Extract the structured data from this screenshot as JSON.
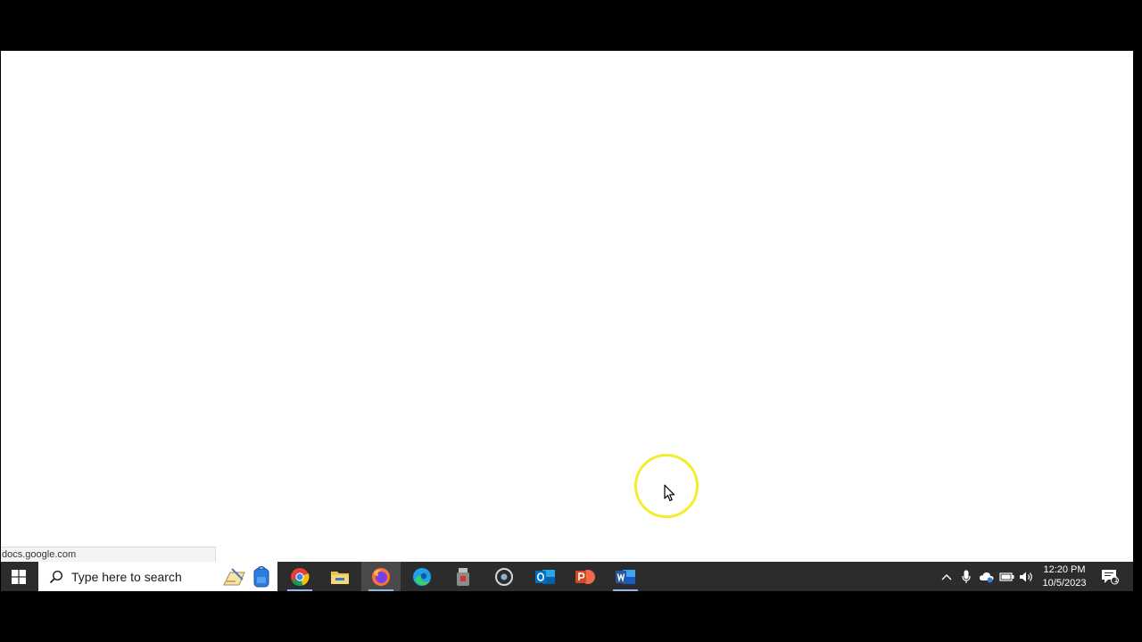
{
  "status_bar": {
    "url": "docs.google.com"
  },
  "taskbar": {
    "search_placeholder": "Type here to search",
    "apps": [
      {
        "name": "sticky-notes-icon"
      },
      {
        "name": "backpack-icon"
      },
      {
        "name": "chrome-icon"
      },
      {
        "name": "file-explorer-icon"
      },
      {
        "name": "firefox-icon"
      },
      {
        "name": "edge-icon"
      },
      {
        "name": "usb-drive-icon"
      },
      {
        "name": "cortana-icon"
      },
      {
        "name": "outlook-icon"
      },
      {
        "name": "powerpoint-icon"
      },
      {
        "name": "word-icon"
      }
    ],
    "clock": {
      "time": "12:20 PM",
      "date": "10/5/2023"
    },
    "notification_count": "1"
  },
  "colors": {
    "taskbar": "#2c2c2c",
    "cursor_highlight": "#f2ee2e",
    "chrome_red": "#db4437",
    "chrome_yellow": "#f4c20d",
    "chrome_green": "#0f9d58",
    "word_blue": "#2b579a",
    "powerpoint_orange": "#d24726",
    "outlook_blue": "#0072c6"
  }
}
